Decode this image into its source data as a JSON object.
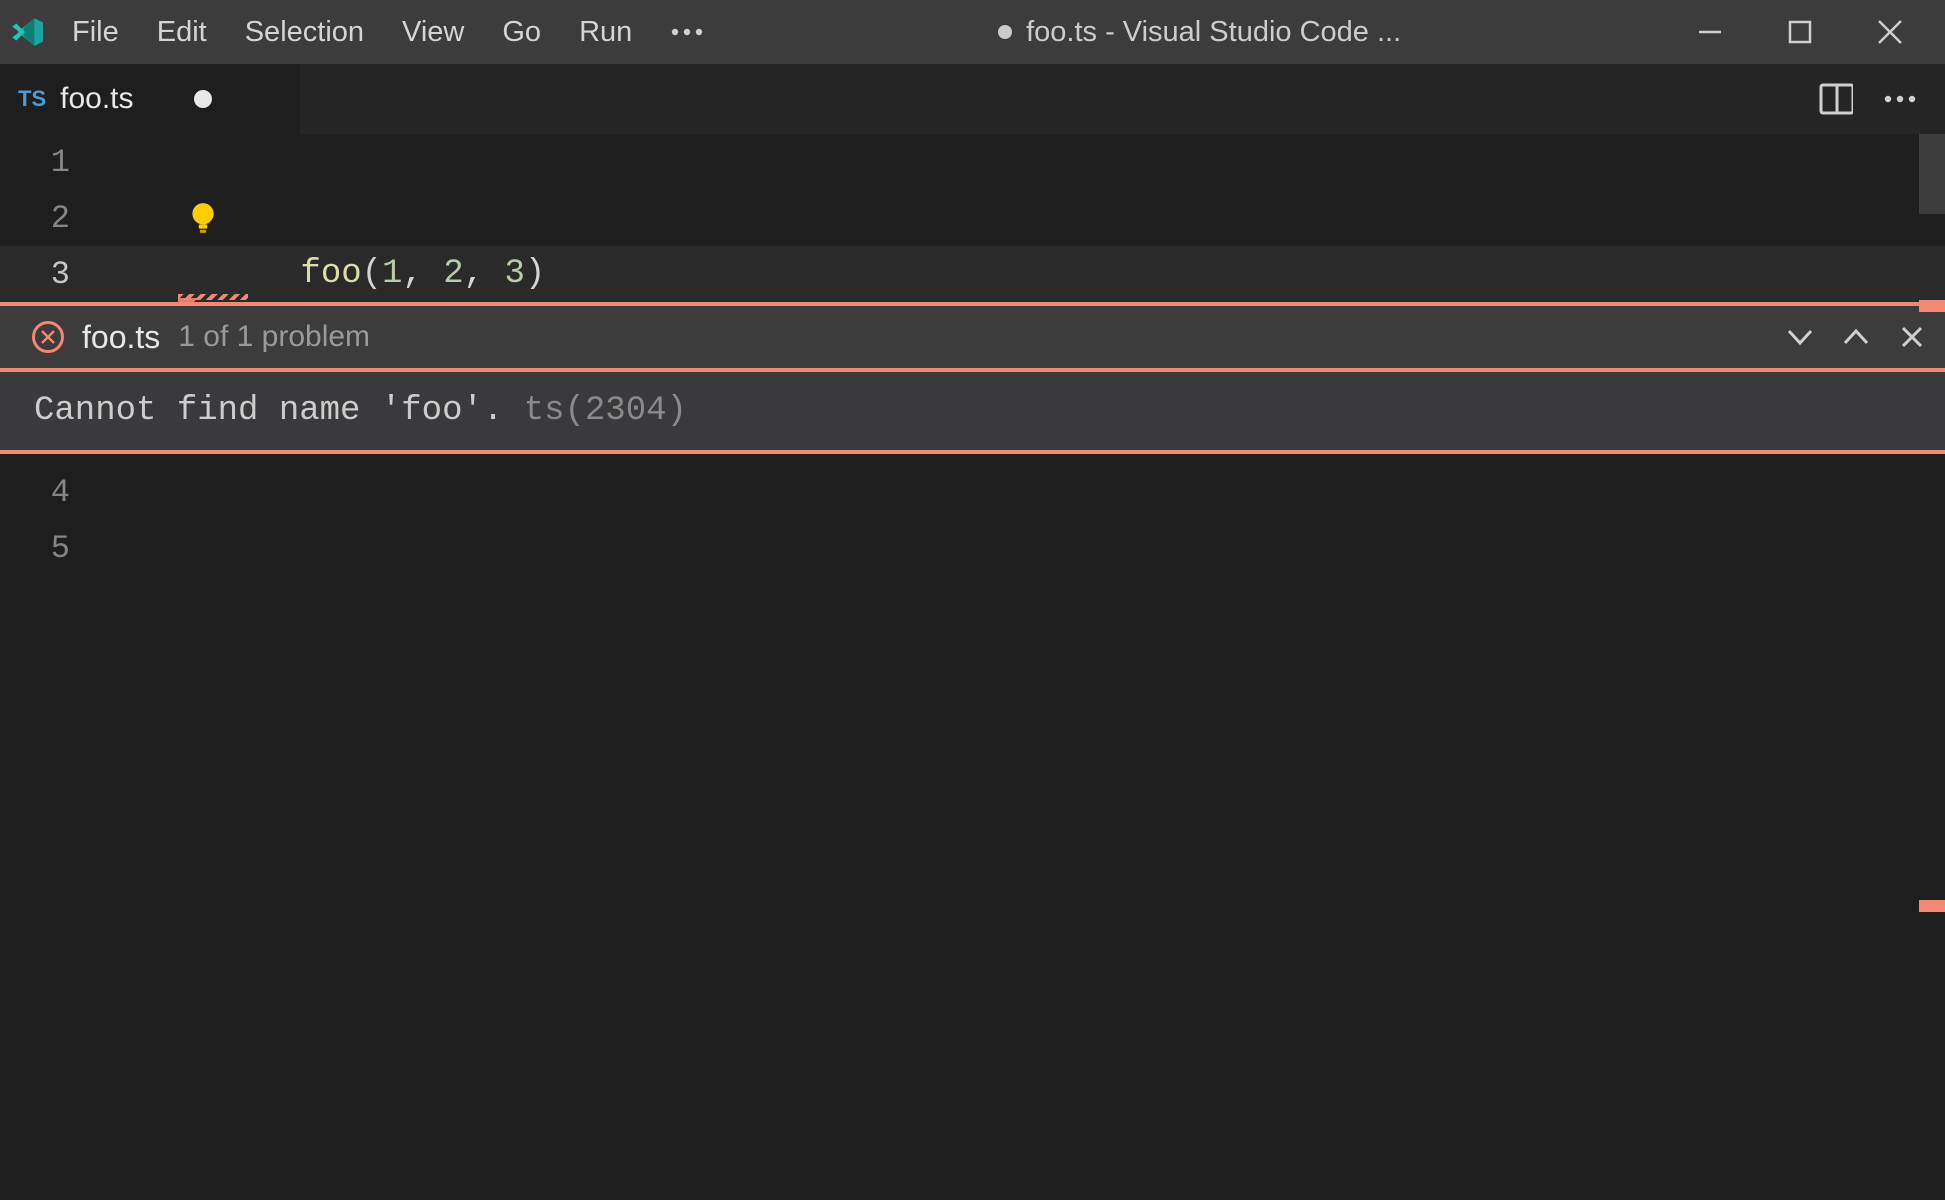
{
  "menu": {
    "file": "File",
    "edit": "Edit",
    "selection": "Selection",
    "view": "View",
    "go": "Go",
    "run": "Run"
  },
  "window_title": "foo.ts - Visual Studio Code ...",
  "tab": {
    "lang_badge": "TS",
    "name": "foo.ts"
  },
  "editor": {
    "lines_above": [
      "1",
      "2",
      "3"
    ],
    "lines_below": [
      "4",
      "5"
    ],
    "code": {
      "fn": "foo",
      "open": "(",
      "n1": "1",
      "c1": ", ",
      "n2": "2",
      "c2": ", ",
      "n3": "3",
      "close": ")"
    }
  },
  "problem": {
    "file": "foo.ts",
    "count_text": "1 of 1 problem",
    "message": "Cannot find name 'foo'. ",
    "code": "ts(2304)"
  }
}
